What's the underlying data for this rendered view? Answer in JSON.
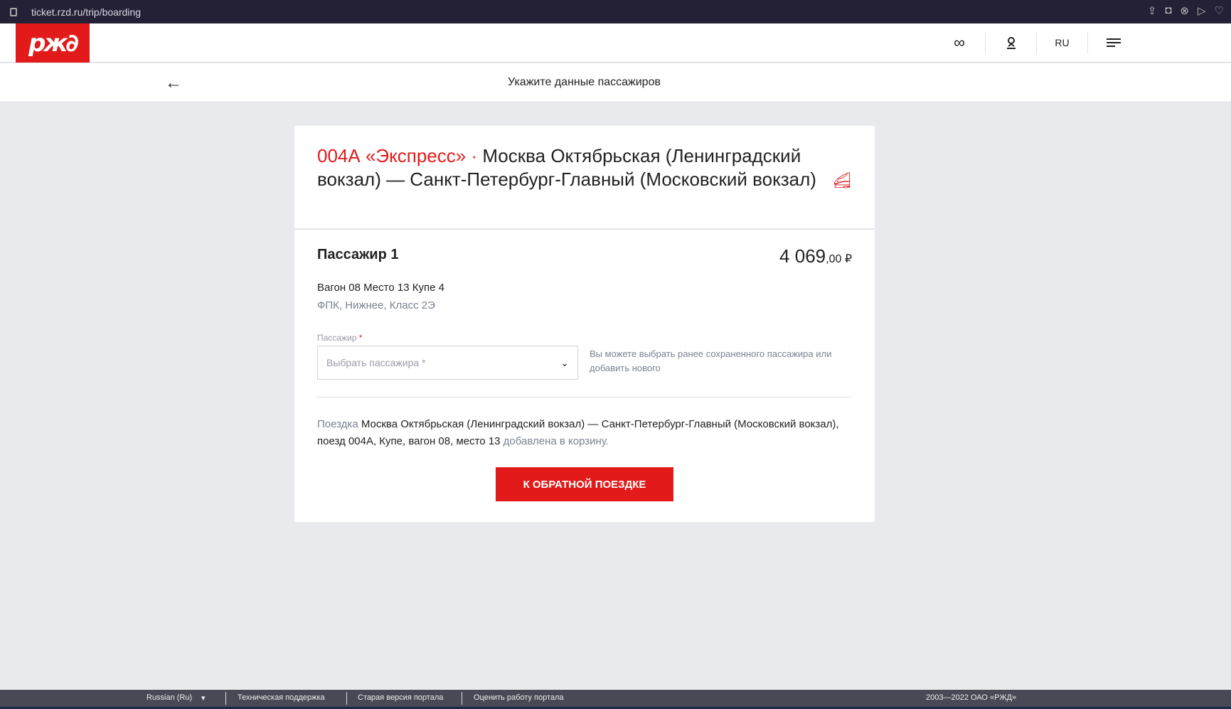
{
  "browser": {
    "url": "ticket.rzd.ru/trip/boarding"
  },
  "header": {
    "logo": "РЖД",
    "lang": "RU"
  },
  "subheader": {
    "title": "Укажите данные пассажиров"
  },
  "trip": {
    "train": "004А «Экспресс»",
    "separator": " · ",
    "route": "Москва Октябрьская (Ленинградский вокзал) — Санкт-Петербург-Главный (Московский вокзал)"
  },
  "passenger": {
    "name": "Пассажир 1",
    "price_main": "4 069",
    "price_fraction": ",00 ₽",
    "seat": "Вагон 08 Место 13 Купе 4",
    "class": "ФПК, Нижнее, Класс 2Э",
    "field_label": "Пассажир",
    "required_mark": "*",
    "select_placeholder": "Выбрать пассажира *",
    "hint": "Вы можете выбрать ранее сохраненного пассажира или добавить нового"
  },
  "note": {
    "prefix": "Поездка",
    "body": " Москва Октябрьская (Ленинградский вокзал) — Санкт-Петербург-Главный (Московский вокзал), поезд 004А, Купе, вагон 08, место 13 ",
    "suffix": "добавлена в корзину."
  },
  "button": "К ОБРАТНОЙ ПОЕЗДКЕ",
  "footer": {
    "lang": "Russian (Ru)",
    "support": "Техническая поддержка",
    "old": "Старая версия портала",
    "rate": "Оценить работу портала",
    "copyright": "2003—2022 ОАО «РЖД»"
  }
}
